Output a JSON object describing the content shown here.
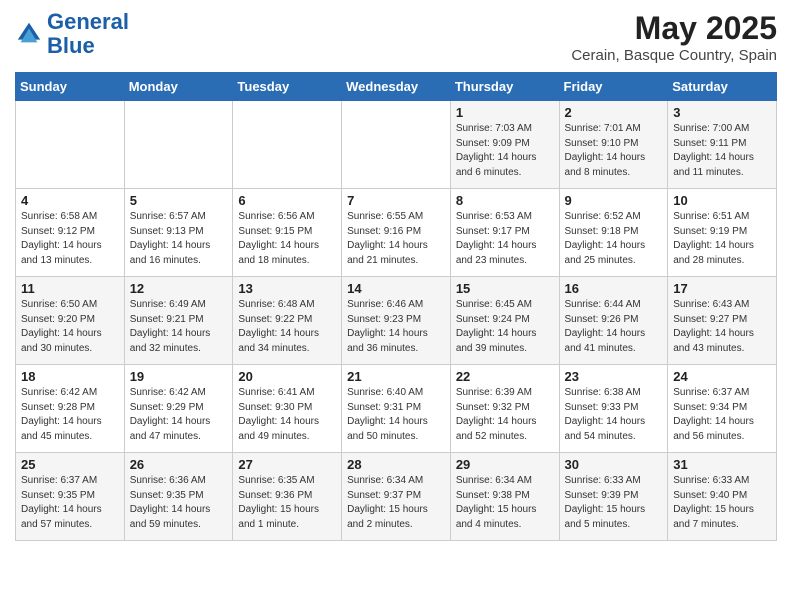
{
  "logo": {
    "line1": "General",
    "line2": "Blue"
  },
  "title": "May 2025",
  "location": "Cerain, Basque Country, Spain",
  "header_days": [
    "Sunday",
    "Monday",
    "Tuesday",
    "Wednesday",
    "Thursday",
    "Friday",
    "Saturday"
  ],
  "weeks": [
    [
      {
        "day": "",
        "info": ""
      },
      {
        "day": "",
        "info": ""
      },
      {
        "day": "",
        "info": ""
      },
      {
        "day": "",
        "info": ""
      },
      {
        "day": "1",
        "info": "Sunrise: 7:03 AM\nSunset: 9:09 PM\nDaylight: 14 hours\nand 6 minutes."
      },
      {
        "day": "2",
        "info": "Sunrise: 7:01 AM\nSunset: 9:10 PM\nDaylight: 14 hours\nand 8 minutes."
      },
      {
        "day": "3",
        "info": "Sunrise: 7:00 AM\nSunset: 9:11 PM\nDaylight: 14 hours\nand 11 minutes."
      }
    ],
    [
      {
        "day": "4",
        "info": "Sunrise: 6:58 AM\nSunset: 9:12 PM\nDaylight: 14 hours\nand 13 minutes."
      },
      {
        "day": "5",
        "info": "Sunrise: 6:57 AM\nSunset: 9:13 PM\nDaylight: 14 hours\nand 16 minutes."
      },
      {
        "day": "6",
        "info": "Sunrise: 6:56 AM\nSunset: 9:15 PM\nDaylight: 14 hours\nand 18 minutes."
      },
      {
        "day": "7",
        "info": "Sunrise: 6:55 AM\nSunset: 9:16 PM\nDaylight: 14 hours\nand 21 minutes."
      },
      {
        "day": "8",
        "info": "Sunrise: 6:53 AM\nSunset: 9:17 PM\nDaylight: 14 hours\nand 23 minutes."
      },
      {
        "day": "9",
        "info": "Sunrise: 6:52 AM\nSunset: 9:18 PM\nDaylight: 14 hours\nand 25 minutes."
      },
      {
        "day": "10",
        "info": "Sunrise: 6:51 AM\nSunset: 9:19 PM\nDaylight: 14 hours\nand 28 minutes."
      }
    ],
    [
      {
        "day": "11",
        "info": "Sunrise: 6:50 AM\nSunset: 9:20 PM\nDaylight: 14 hours\nand 30 minutes."
      },
      {
        "day": "12",
        "info": "Sunrise: 6:49 AM\nSunset: 9:21 PM\nDaylight: 14 hours\nand 32 minutes."
      },
      {
        "day": "13",
        "info": "Sunrise: 6:48 AM\nSunset: 9:22 PM\nDaylight: 14 hours\nand 34 minutes."
      },
      {
        "day": "14",
        "info": "Sunrise: 6:46 AM\nSunset: 9:23 PM\nDaylight: 14 hours\nand 36 minutes."
      },
      {
        "day": "15",
        "info": "Sunrise: 6:45 AM\nSunset: 9:24 PM\nDaylight: 14 hours\nand 39 minutes."
      },
      {
        "day": "16",
        "info": "Sunrise: 6:44 AM\nSunset: 9:26 PM\nDaylight: 14 hours\nand 41 minutes."
      },
      {
        "day": "17",
        "info": "Sunrise: 6:43 AM\nSunset: 9:27 PM\nDaylight: 14 hours\nand 43 minutes."
      }
    ],
    [
      {
        "day": "18",
        "info": "Sunrise: 6:42 AM\nSunset: 9:28 PM\nDaylight: 14 hours\nand 45 minutes."
      },
      {
        "day": "19",
        "info": "Sunrise: 6:42 AM\nSunset: 9:29 PM\nDaylight: 14 hours\nand 47 minutes."
      },
      {
        "day": "20",
        "info": "Sunrise: 6:41 AM\nSunset: 9:30 PM\nDaylight: 14 hours\nand 49 minutes."
      },
      {
        "day": "21",
        "info": "Sunrise: 6:40 AM\nSunset: 9:31 PM\nDaylight: 14 hours\nand 50 minutes."
      },
      {
        "day": "22",
        "info": "Sunrise: 6:39 AM\nSunset: 9:32 PM\nDaylight: 14 hours\nand 52 minutes."
      },
      {
        "day": "23",
        "info": "Sunrise: 6:38 AM\nSunset: 9:33 PM\nDaylight: 14 hours\nand 54 minutes."
      },
      {
        "day": "24",
        "info": "Sunrise: 6:37 AM\nSunset: 9:34 PM\nDaylight: 14 hours\nand 56 minutes."
      }
    ],
    [
      {
        "day": "25",
        "info": "Sunrise: 6:37 AM\nSunset: 9:35 PM\nDaylight: 14 hours\nand 57 minutes."
      },
      {
        "day": "26",
        "info": "Sunrise: 6:36 AM\nSunset: 9:35 PM\nDaylight: 14 hours\nand 59 minutes."
      },
      {
        "day": "27",
        "info": "Sunrise: 6:35 AM\nSunset: 9:36 PM\nDaylight: 15 hours\nand 1 minute."
      },
      {
        "day": "28",
        "info": "Sunrise: 6:34 AM\nSunset: 9:37 PM\nDaylight: 15 hours\nand 2 minutes."
      },
      {
        "day": "29",
        "info": "Sunrise: 6:34 AM\nSunset: 9:38 PM\nDaylight: 15 hours\nand 4 minutes."
      },
      {
        "day": "30",
        "info": "Sunrise: 6:33 AM\nSunset: 9:39 PM\nDaylight: 15 hours\nand 5 minutes."
      },
      {
        "day": "31",
        "info": "Sunrise: 6:33 AM\nSunset: 9:40 PM\nDaylight: 15 hours\nand 7 minutes."
      }
    ]
  ]
}
